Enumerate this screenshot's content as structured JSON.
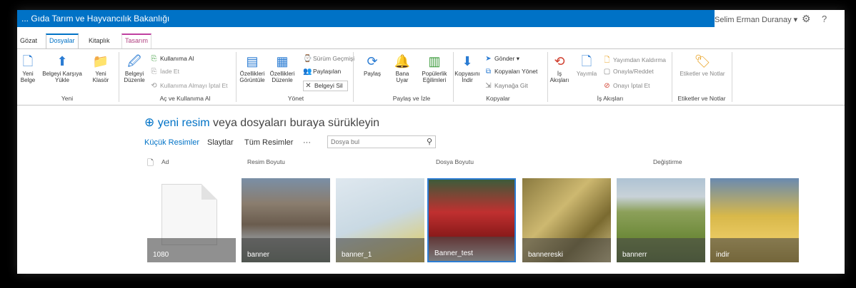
{
  "suite": {
    "title": "... Gıda Tarım ve Hayvancılık Bakanlığı",
    "user": "Selim Erman Duranay ▾",
    "gear": "⚙",
    "help": "?"
  },
  "tabs": [
    "Gözat",
    "Dosyalar",
    "Kitaplık",
    "Tasarım"
  ],
  "ribbon": {
    "new_doc": "Yeni Belge",
    "upload": "Belgeyi Karşıya Yükle",
    "new_folder": "Yeni Klasör",
    "edit_doc": "Belgeyi Düzenle",
    "check_out": "Kullanıma Al",
    "check_in": "İade Et",
    "discard_checkout": "Kullanıma Almayı İptal Et",
    "view_props": "Özellikleri Görüntüle",
    "edit_props": "Özellikleri Düzenle",
    "version_history": "Sürüm Geçmişi",
    "shared_with": "Paylaşılan",
    "delete_doc": "Belgeyi Sil",
    "share": "Paylaş",
    "alert_me": "Bana Uyar",
    "popularity": "Popülerlik Eğilimleri",
    "download_copy": "Kopyasını İndir",
    "send_to": "Gönder ▾",
    "manage_copies": "Kopyaları Yönet",
    "go_source": "Kaynağa Git",
    "workflows": "İş Akışları",
    "publish": "Yayımla",
    "unpublish": "Yayımdan Kaldırma",
    "approve_reject": "Onayla/Reddet",
    "cancel_approval": "Onayı İptal Et",
    "tags_notes": "Etiketler ve Notlar",
    "groups": {
      "new": "Yeni",
      "open_checkout": "Aç ve Kullanıma Al",
      "manage": "Yönet",
      "share_track": "Paylaş ve İzle",
      "copies": "Kopyalar",
      "workflows": "İş Akışları",
      "tags": "Etiketler ve Notlar"
    }
  },
  "main": {
    "upload_new": "yeni resim",
    "upload_rest": " veya dosyaları buraya sürükleyin",
    "views": [
      "Küçük Resimler",
      "Slaytlar",
      "Tüm Resimler",
      "···"
    ],
    "search_placeholder": "Dosya bul",
    "columns": [
      "Ad",
      "Resim Boyutu",
      "Dosya Boyutu",
      "Değiştirme"
    ],
    "thumbnails": [
      "1080",
      "banner",
      "banner_1",
      "Banner_test",
      "bannereski",
      "bannerr",
      "indir"
    ]
  }
}
